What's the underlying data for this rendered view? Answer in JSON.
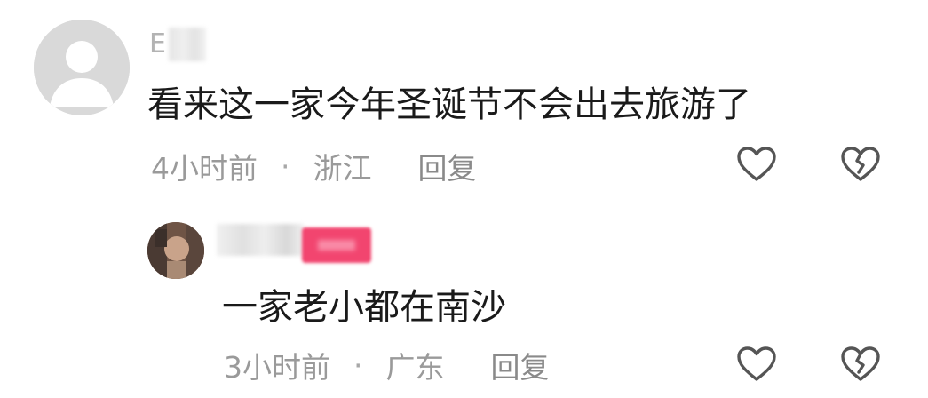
{
  "comments": [
    {
      "username_visible": "E",
      "text": "看来这一家今年圣诞节不会出去旅游了",
      "time": "4小时前",
      "separator": "·",
      "location": "浙江",
      "reply_label": "回复",
      "avatar_icon": "default-user-avatar-icon",
      "like_icon": "heart-outline-icon",
      "dislike_icon": "broken-heart-icon",
      "replies": [
        {
          "text": "一家老小都在南沙",
          "time": "3小时前",
          "separator": "·",
          "location": "广东",
          "reply_label": "回复",
          "author_badge_color": "#f2456f",
          "like_icon": "heart-outline-icon",
          "dislike_icon": "broken-heart-icon"
        }
      ]
    }
  ],
  "colors": {
    "background": "#ffffff",
    "text_primary": "#1a1a1a",
    "text_meta": "#9a9a9a",
    "icon_stroke": "#555555",
    "author_badge": "#f2456f"
  }
}
